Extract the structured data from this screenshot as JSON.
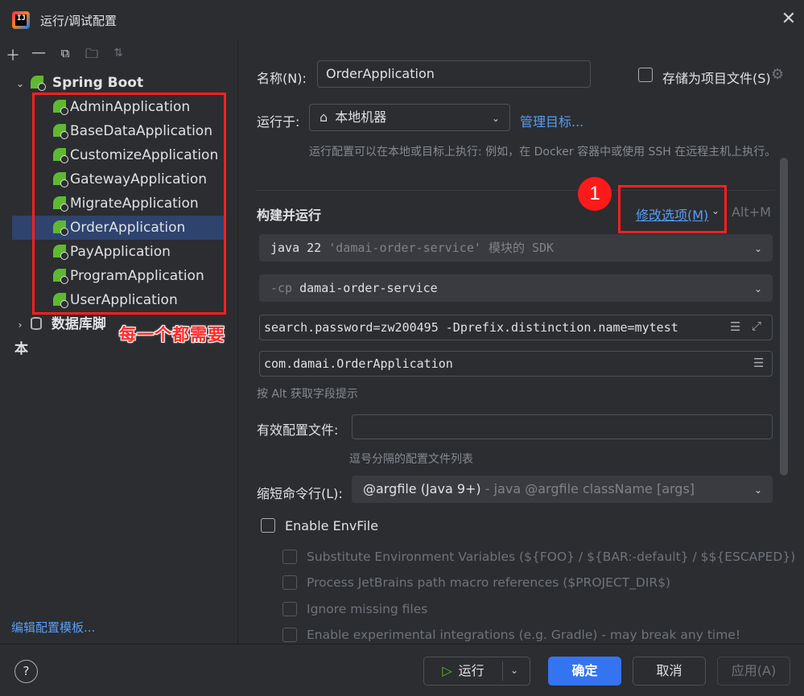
{
  "window": {
    "title": "运行/调试配置"
  },
  "left": {
    "toolbar": [
      "add",
      "remove",
      "copy",
      "new-folder",
      "sort"
    ],
    "group_label": "Spring Boot",
    "items": [
      "AdminApplication",
      "BaseDataApplication",
      "CustomizeApplication",
      "GatewayApplication",
      "MigrateApplication",
      "OrderApplication",
      "PayApplication",
      "ProgramApplication",
      "UserApplication"
    ],
    "db_group_label": "数据库脚本",
    "annotation": "每一个都需要",
    "edit_templates": "编辑配置模板..."
  },
  "form": {
    "name_label": "名称(N):",
    "name_value": "OrderApplication",
    "store_label": "存储为项目文件(S)",
    "run_on_label": "运行于:",
    "run_on_value": "本地机器",
    "manage_targets": "管理目标...",
    "run_on_hint": "运行配置可以在本地或目标上执行: 例如，在 Docker 容器中或使用 SSH 在远程主机上执行。",
    "build_run_title": "构建并运行",
    "modify_options": "修改选项(M)",
    "modify_shortcut": "Alt+M",
    "badge_number": "1",
    "jdk_prefix": "java 22",
    "jdk_module": "'damai-order-service'",
    "jdk_suffix": "模块的 SDK",
    "cp_prefix": "-cp",
    "cp_value": "damai-order-service",
    "vm_options": "search.password=zw200495 -Dprefix.distinction.name=mytest",
    "main_class": "com.damai.OrderApplication",
    "alt_hint": "按 Alt 获取字段提示",
    "profiles_label": "有效配置文件:",
    "profiles_value": "",
    "profiles_hint": "逗号分隔的配置文件列表",
    "shorten_label": "缩短命令行(L):",
    "shorten_value": "@argfile (Java 9+)",
    "shorten_desc": "- java @argfile className [args]",
    "envfile_label": "Enable EnvFile",
    "env_options": [
      "Substitute Environment Variables (${FOO} / ${BAR:-default} / $${ESCAPED})",
      "Process JetBrains path macro references ($PROJECT_DIR$)",
      "Ignore missing files",
      "Enable experimental integrations (e.g. Gradle) - may break any time!"
    ]
  },
  "footer": {
    "help": "?",
    "run": "运行",
    "ok": "确定",
    "cancel": "取消",
    "apply": "应用(A)"
  },
  "colors": {
    "background": "#2b2d30",
    "selection": "#2e436e",
    "accent": "#3574f0",
    "link": "#589df6",
    "annotation_red": "#ff2020",
    "spring_green": "#5fb832"
  }
}
